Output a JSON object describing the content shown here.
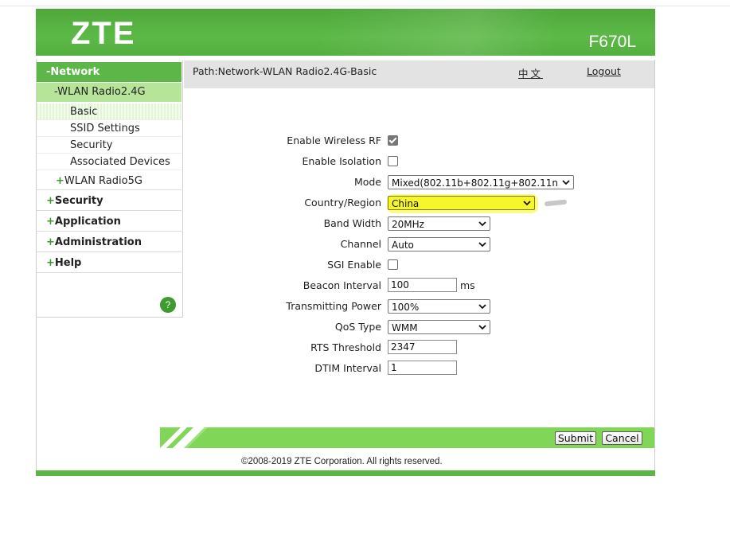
{
  "header": {
    "logo": "ZTE",
    "model": "F670L"
  },
  "sidebar": {
    "network": "-Network",
    "wlan24": "-WLAN Radio2.4G",
    "subitems": [
      "Basic",
      "SSID Settings",
      "Security",
      "Associated Devices"
    ],
    "wlan5": "WLAN Radio5G",
    "main": [
      "Security",
      "Application",
      "Administration",
      "Help"
    ],
    "help_badge": "?"
  },
  "pathbar": {
    "path": "Path:Network-WLAN Radio2.4G-Basic",
    "language": "中文",
    "logout": "Logout"
  },
  "form": {
    "enable_wireless_rf": {
      "label": "Enable Wireless RF",
      "checked": true
    },
    "enable_isolation": {
      "label": "Enable Isolation",
      "checked": false
    },
    "mode": {
      "label": "Mode",
      "value": "Mixed(802.11b+802.11g+802.11n"
    },
    "country_region": {
      "label": "Country/Region",
      "value": "China"
    },
    "band_width": {
      "label": "Band Width",
      "value": "20MHz"
    },
    "channel": {
      "label": "Channel",
      "value": "Auto"
    },
    "sgi_enable": {
      "label": "SGI Enable",
      "checked": false
    },
    "beacon_interval": {
      "label": "Beacon Interval",
      "value": "100",
      "unit": "ms"
    },
    "transmitting_power": {
      "label": "Transmitting Power",
      "value": "100%"
    },
    "qos_type": {
      "label": "QoS Type",
      "value": "WMM"
    },
    "rts_threshold": {
      "label": "RTS Threshold",
      "value": "2347"
    },
    "dtim_interval": {
      "label": "DTIM Interval",
      "value": "1"
    }
  },
  "buttons": {
    "submit": "Submit",
    "cancel": "Cancel"
  },
  "footer": {
    "copyright": "©2008-2019 ZTE Corporation. All rights reserved."
  },
  "colors": {
    "brand_green": "#5cb947",
    "highlight_yellow": "#f6f62a"
  }
}
